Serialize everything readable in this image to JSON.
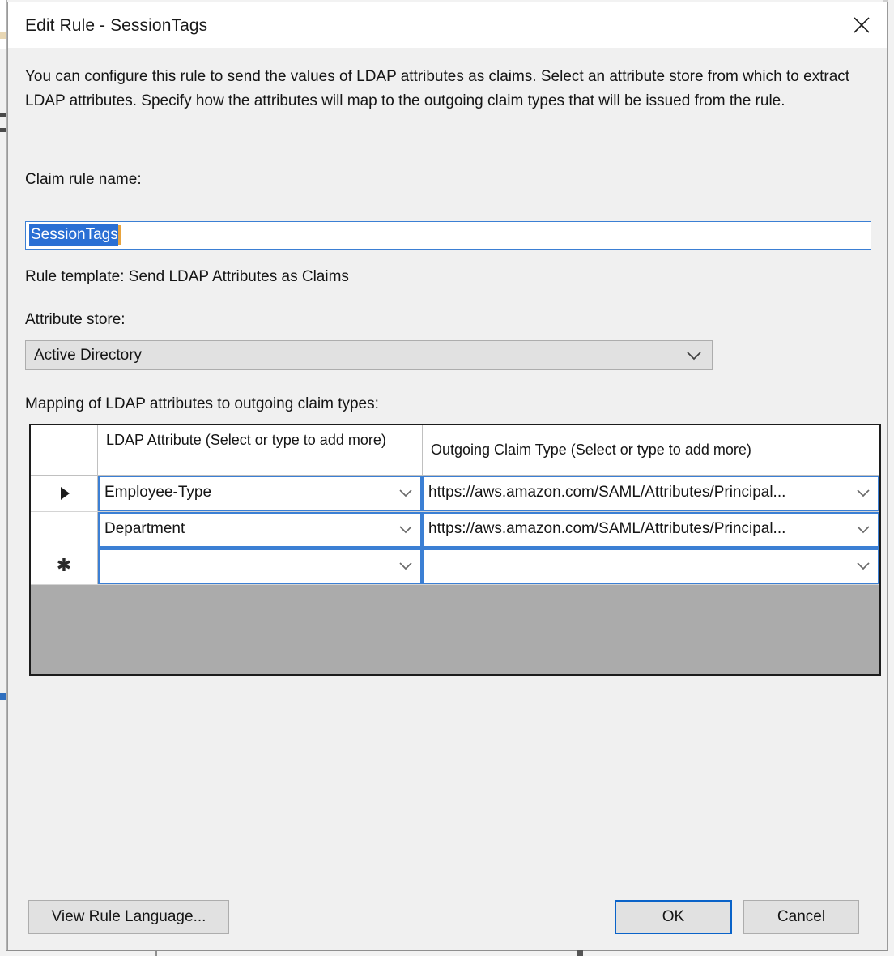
{
  "window": {
    "title": "Edit Rule - SessionTags",
    "close_icon": "close-icon"
  },
  "description": "You can configure this rule to send the values of LDAP attributes as claims. Select an attribute store from which to extract LDAP attributes. Specify how the attributes will map to the outgoing claim types that will be issued from the rule.",
  "fields": {
    "rule_name_label": "Claim rule name:",
    "rule_name_value": "SessionTags",
    "rule_template_label": "Rule template: Send LDAP Attributes as Claims",
    "attribute_store_label": "Attribute store:",
    "attribute_store_value": "Active Directory",
    "mapping_label": "Mapping of LDAP attributes to outgoing claim types:"
  },
  "grid": {
    "columns": [
      "LDAP Attribute (Select or type to add more)",
      "Outgoing Claim Type (Select or type to add more)"
    ],
    "rows": [
      {
        "marker": "current-row-arrow",
        "ldap_attribute": "Employee-Type",
        "outgoing_claim_type": "https://aws.amazon.com/SAML/Attributes/Principal..."
      },
      {
        "marker": "",
        "ldap_attribute": "Department",
        "outgoing_claim_type": "https://aws.amazon.com/SAML/Attributes/Principal..."
      },
      {
        "marker": "new-row-asterisk",
        "ldap_attribute": "",
        "outgoing_claim_type": ""
      }
    ]
  },
  "buttons": {
    "view_rule_language": "View Rule Language...",
    "ok": "OK",
    "cancel": "Cancel"
  },
  "colors": {
    "accent": "#2a6fd4",
    "focus_border": "#0a63c9",
    "grid_empty": "#ababab",
    "dialog_bg": "#f0f0f0",
    "caret": "#e8a33d"
  }
}
